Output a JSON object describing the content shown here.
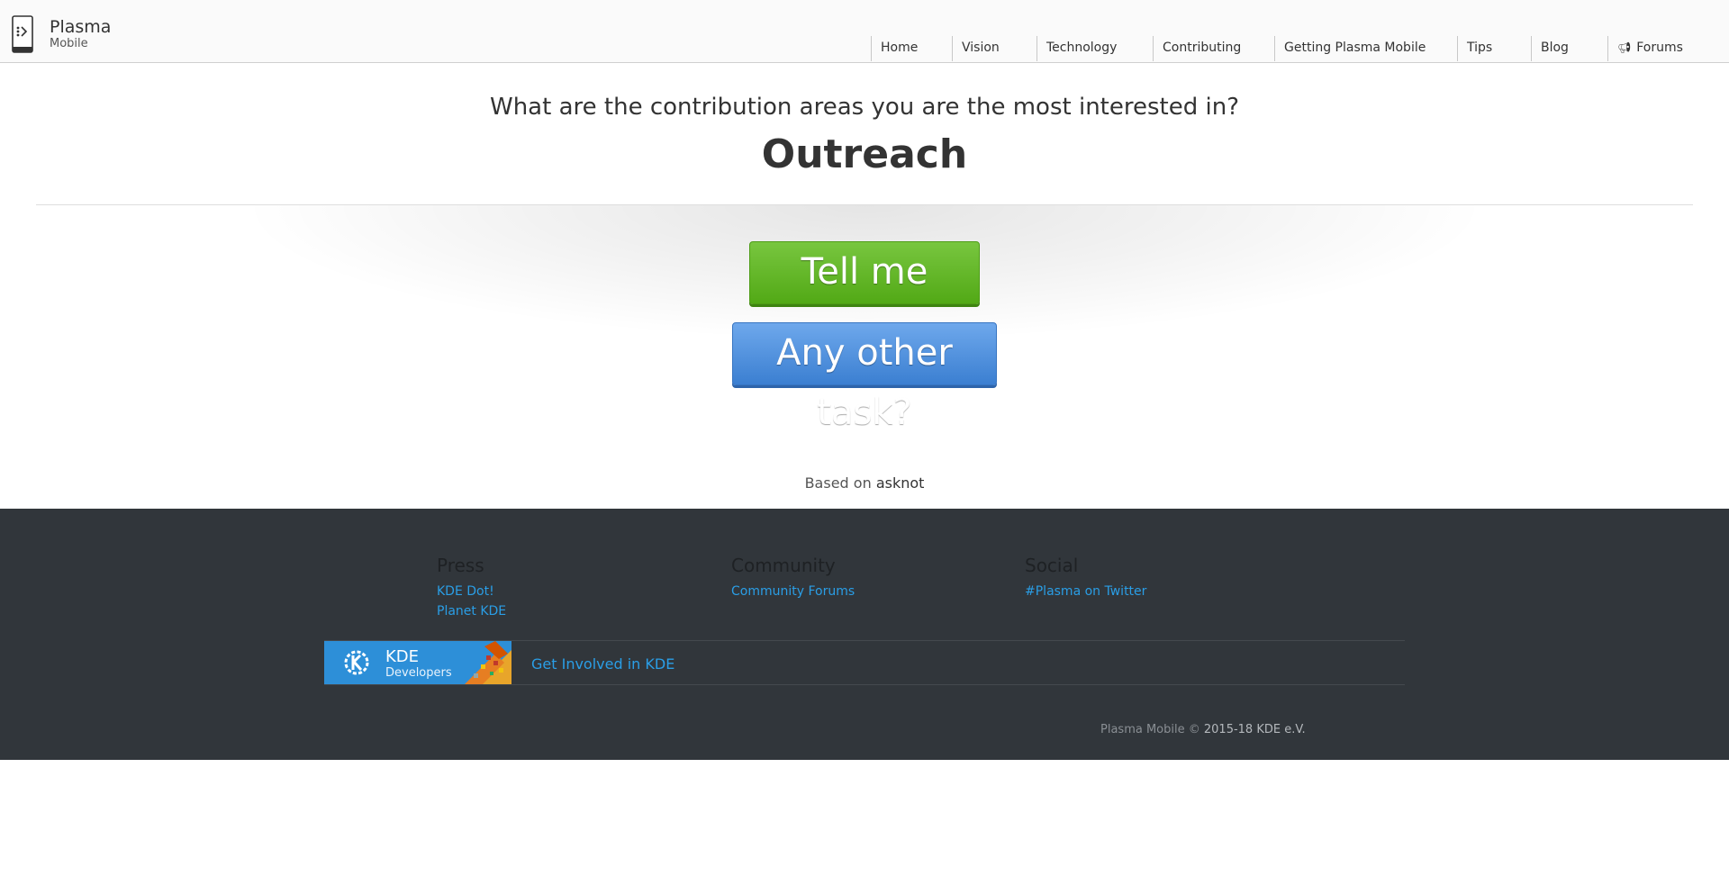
{
  "header": {
    "logo_title": "Plasma",
    "logo_subtitle": "Mobile",
    "nav": [
      {
        "label": "Home"
      },
      {
        "label": "Vision"
      },
      {
        "label": "Technology"
      },
      {
        "label": "Contributing"
      },
      {
        "label": "Getting Plasma Mobile"
      },
      {
        "label": "Tips"
      },
      {
        "label": "Blog"
      },
      {
        "label": "Forums",
        "icon": "megaphone-icon"
      }
    ]
  },
  "hero": {
    "question": "What are the contribution areas you are the most interested in?",
    "area": "Outreach",
    "primary_button": "Tell me more",
    "secondary_button": "Any other task?",
    "based_on_prefix": "Based on",
    "based_on_link": "asknot"
  },
  "footer": {
    "columns": [
      {
        "title": "Press",
        "links": [
          "KDE Dot!",
          "Planet KDE"
        ]
      },
      {
        "title": "Community",
        "links": [
          "Community Forums"
        ]
      },
      {
        "title": "Social",
        "links": [
          "#Plasma on Twitter"
        ]
      }
    ],
    "kde_badge": {
      "name": "KDE",
      "subtitle": "Developers"
    },
    "get_involved": "Get Involved in KDE",
    "copyright_prefix": "Plasma Mobile ©",
    "copyright_link": "2015-18 KDE e.V."
  },
  "colors": {
    "green_button": "#5cb324",
    "blue_button": "#4a8ee0",
    "footer_bg": "#31363b",
    "link_blue": "#2a9ee6"
  }
}
